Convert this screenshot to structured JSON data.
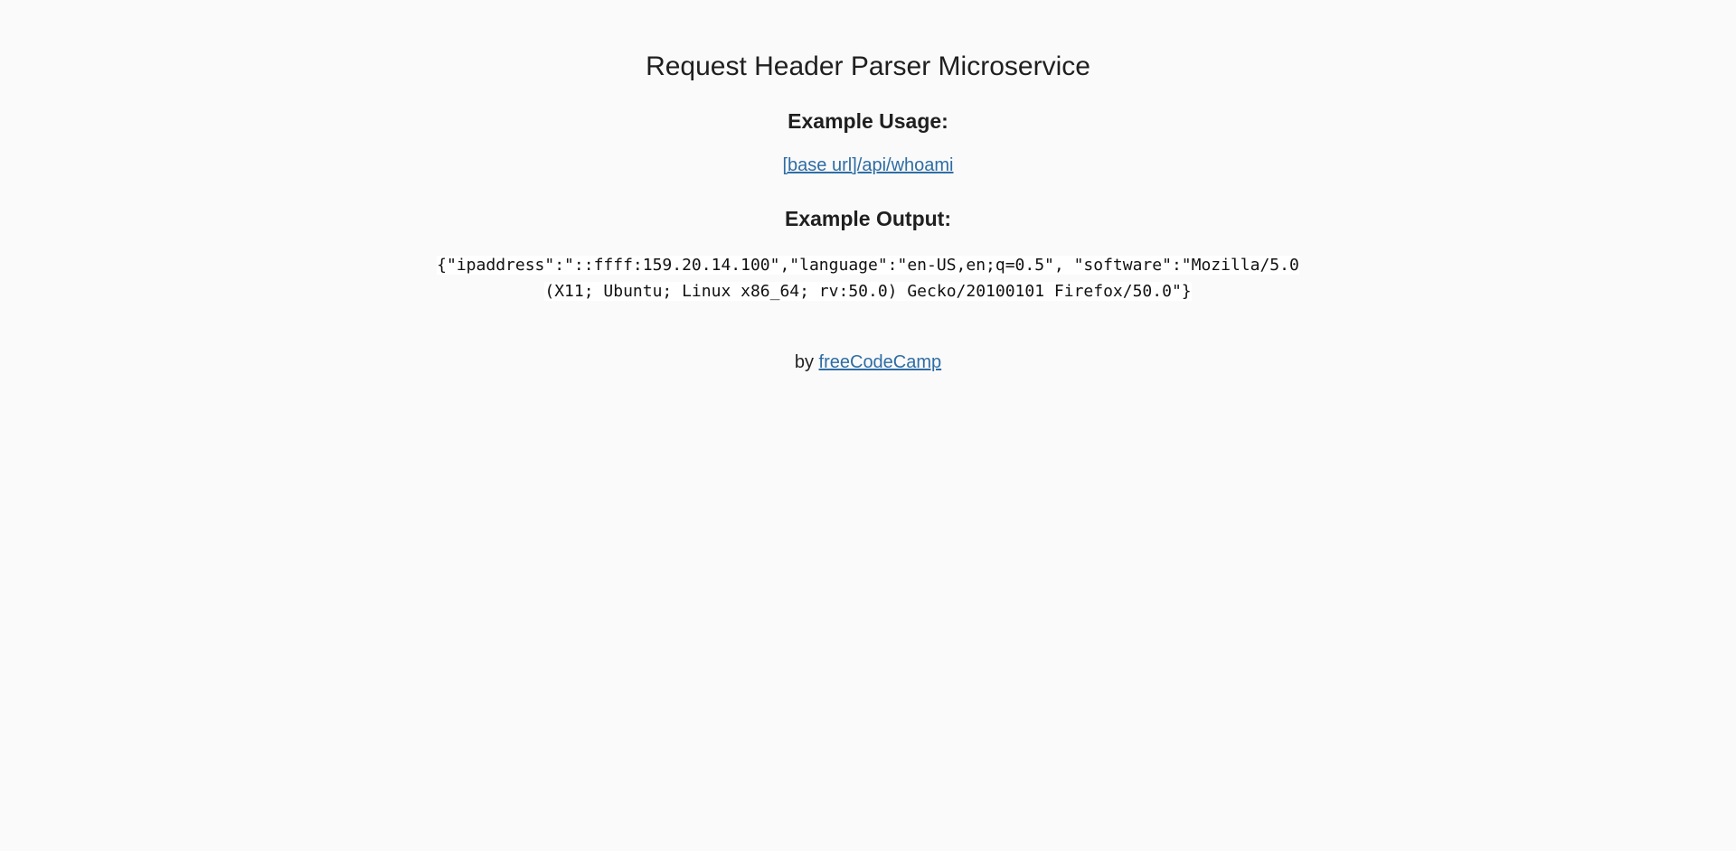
{
  "page": {
    "title": "Request Header Parser Microservice"
  },
  "usage": {
    "heading": "Example Usage:",
    "link_text": "[base url]/api/whoami"
  },
  "output": {
    "heading": "Example Output:",
    "sample": "{\"ipaddress\":\"::ffff:159.20.14.100\",\"language\":\"en-US,en;q=0.5\", \"software\":\"Mozilla/5.0 (X11; Ubuntu; Linux x86_64; rv:50.0) Gecko/20100101 Firefox/50.0\"}"
  },
  "footer": {
    "by_text": "by",
    "link_text": "freeCodeCamp"
  },
  "colors": {
    "background": "#fafafa",
    "link": "#2e6da4",
    "text": "#222222"
  }
}
